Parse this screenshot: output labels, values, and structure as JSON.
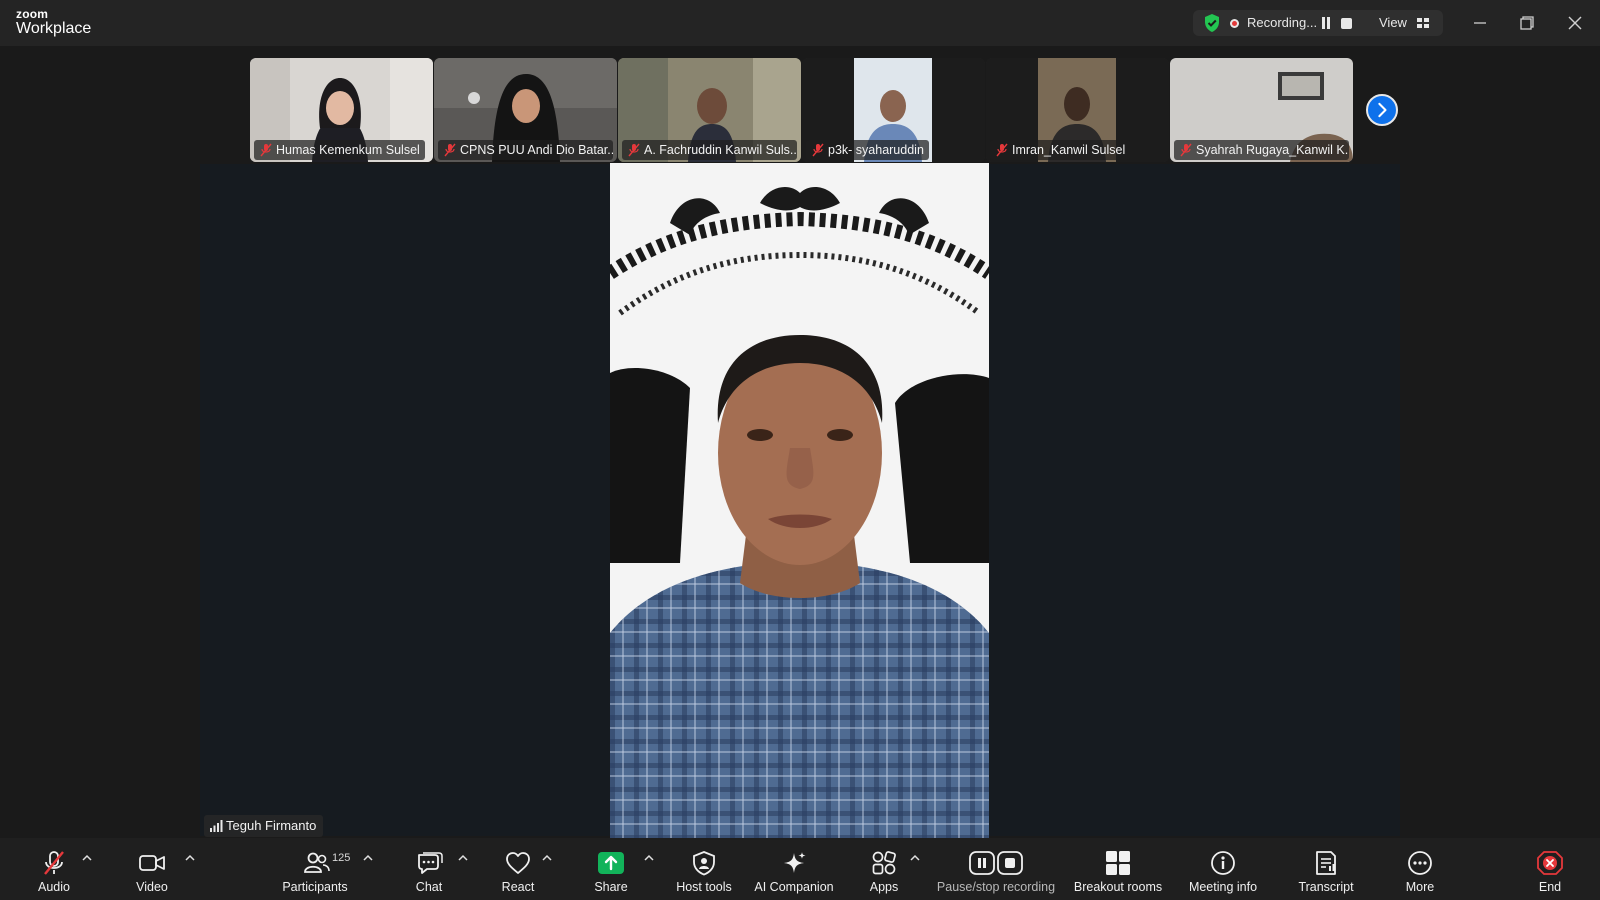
{
  "app": {
    "brand_small": "zoom",
    "brand_large": "Workplace"
  },
  "recording": {
    "status_text": "Recording...",
    "view_label": "View"
  },
  "participants_strip": [
    {
      "name": "Humas Kemenkum Sulsel"
    },
    {
      "name": "CPNS PUU Andi Dio Batar..."
    },
    {
      "name": "A. Fachruddin Kanwil Suls..."
    },
    {
      "name": "p3k- syaharuddin"
    },
    {
      "name": "Imran_Kanwil Sulsel"
    },
    {
      "name": "Syahrah Rugaya_Kanwil K..."
    }
  ],
  "active_speaker": {
    "name": "Teguh Firmanto"
  },
  "toolbar": {
    "audio": "Audio",
    "video": "Video",
    "participants": "Participants",
    "participants_count": "125",
    "chat": "Chat",
    "react": "React",
    "share": "Share",
    "host_tools": "Host tools",
    "ai_companion": "AI Companion",
    "apps": "Apps",
    "pause_stop_recording": "Pause/stop recording",
    "breakout_rooms": "Breakout rooms",
    "meeting_info": "Meeting info",
    "transcript": "Transcript",
    "more": "More",
    "end": "End"
  },
  "colors": {
    "accent_blue": "#0e71eb",
    "share_green": "#12b35a",
    "end_red": "#e5383b",
    "shield_green": "#23c552"
  }
}
